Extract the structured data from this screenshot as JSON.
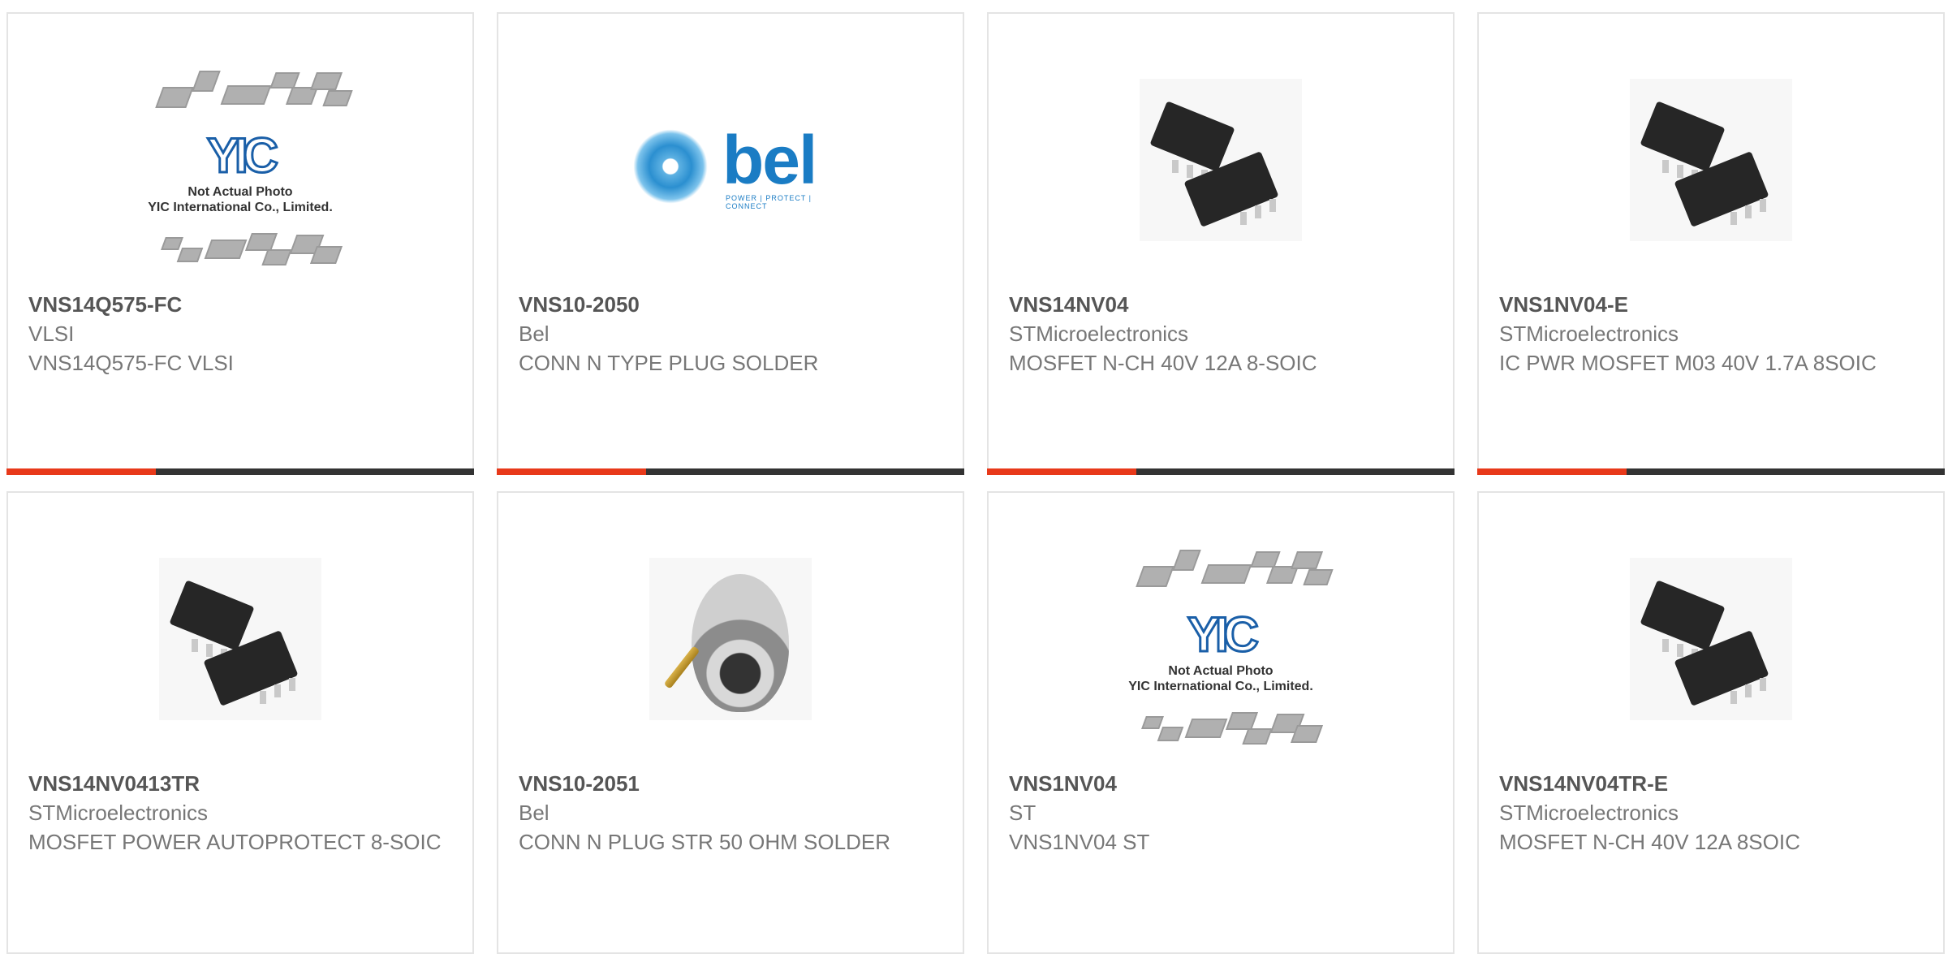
{
  "products": [
    {
      "part": "VNS14Q575-FC",
      "maker": "VLSI",
      "desc": "VNS14Q575-FC VLSI",
      "image": "placeholder-photo"
    },
    {
      "part": "VNS10-2050",
      "maker": "Bel",
      "desc": "CONN N TYPE PLUG SOLDER",
      "image": "bel-logo"
    },
    {
      "part": "VNS14NV04",
      "maker": "STMicroelectronics",
      "desc": "MOSFET N-CH 40V 12A 8-SOIC",
      "image": "soic-chip"
    },
    {
      "part": "VNS1NV04-E",
      "maker": "STMicroelectronics",
      "desc": "IC PWR MOSFET M03 40V 1.7A 8SOIC",
      "image": "soic-chip"
    },
    {
      "part": "VNS14NV0413TR",
      "maker": "STMicroelectronics",
      "desc": "MOSFET POWER AUTOPROTECT 8-SOIC",
      "image": "soic-chip"
    },
    {
      "part": "VNS10-2051",
      "maker": "Bel",
      "desc": "CONN N PLUG STR 50 OHM SOLDER",
      "image": "n-connector"
    },
    {
      "part": "VNS1NV04",
      "maker": "ST",
      "desc": "VNS1NV04 ST",
      "image": "placeholder-photo"
    },
    {
      "part": "VNS14NV04TR-E",
      "maker": "STMicroelectronics",
      "desc": "MOSFET N-CH 40V 12A 8SOIC",
      "image": "soic-chip"
    }
  ],
  "placeholder": {
    "logo": "YIC",
    "line1": "Not Actual Photo",
    "line2": "YIC International Co., Limited."
  },
  "bel_logo": {
    "word": "bel",
    "tagline": "POWER | PROTECT | CONNECT"
  },
  "colors": {
    "accent": "#e8391a",
    "bar": "#333333",
    "border": "#e4e4e4"
  }
}
